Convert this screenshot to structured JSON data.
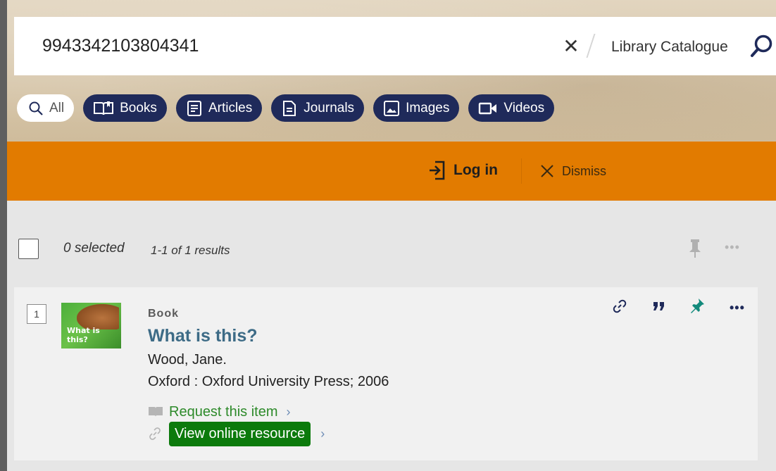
{
  "search": {
    "query": "9943342103804341",
    "scope": "Library Catalogue"
  },
  "tabs": [
    {
      "label": "All",
      "icon": "search-icon",
      "active": true
    },
    {
      "label": "Books",
      "icon": "book-icon"
    },
    {
      "label": "Articles",
      "icon": "article-icon"
    },
    {
      "label": "Journals",
      "icon": "journal-icon"
    },
    {
      "label": "Images",
      "icon": "image-icon"
    },
    {
      "label": "Videos",
      "icon": "video-icon"
    }
  ],
  "banner": {
    "login_label": "Log in",
    "dismiss_label": "Dismiss",
    "color": "#e27b00"
  },
  "results": {
    "selected_label": "0 selected",
    "count_label": "1-1 of 1 results"
  },
  "record": {
    "rank": "1",
    "type": "Book",
    "title": "What is this?",
    "thumbnail_text": "What is this?",
    "author": "Wood, Jane.",
    "publication": "Oxford : Oxford University Press; 2006",
    "request_label": "Request this item",
    "online_label": "View online resource"
  },
  "colors": {
    "nav_pill": "#1f2a5a",
    "link_green": "#2d8a2a",
    "online_button": "#0c7a0c",
    "title_link": "#3d6b86",
    "pin_teal": "#138a7c"
  }
}
